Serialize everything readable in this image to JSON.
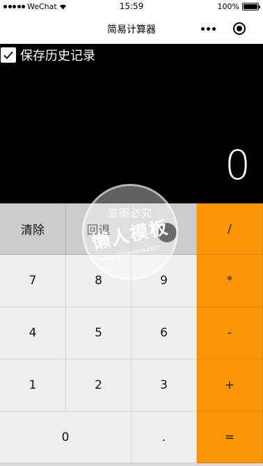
{
  "status_bar": {
    "carrier": "WeChat",
    "time": "15:59",
    "battery": "100%",
    "battery_level": 1.0
  },
  "nav": {
    "title": "简易计算器"
  },
  "display": {
    "save_history_label": "保存历史记录",
    "save_history_checked": true,
    "value": "0"
  },
  "keypad": {
    "clear": "清除",
    "backspace": "回退",
    "divide": "/",
    "seven": "7",
    "eight": "8",
    "nine": "9",
    "multiply": "*",
    "four": "4",
    "five": "5",
    "six": "6",
    "subtract": "-",
    "one": "1",
    "two": "2",
    "three": "3",
    "add": "+",
    "zero": "0",
    "dot": ".",
    "equals": "="
  },
  "watermark": {
    "line1": "盗图必究",
    "line2": "懒人模板",
    "url": "www.lanrenmb.com"
  },
  "colors": {
    "display_bg": "#000000",
    "operator": "#fd9509",
    "function_key": "#cccccc",
    "number_key": "#efefed"
  }
}
